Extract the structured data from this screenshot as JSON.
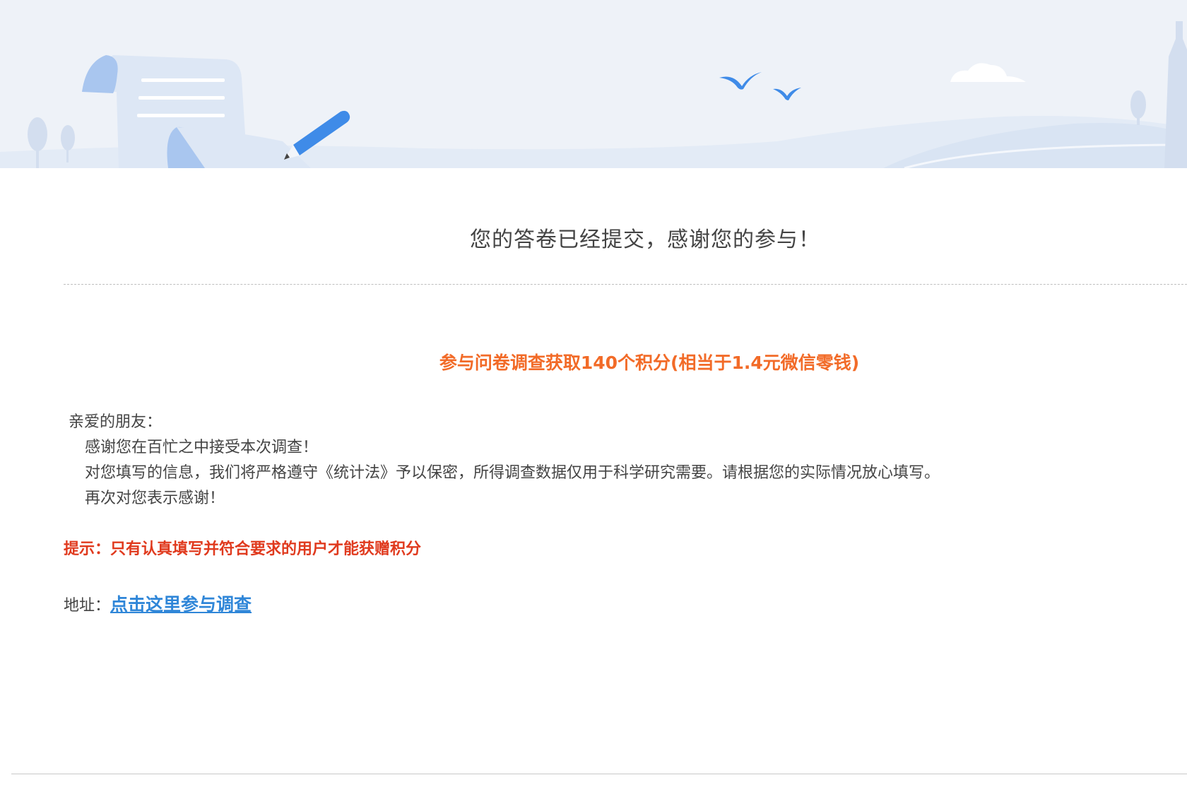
{
  "header": {
    "title": "您的答卷已经提交，感谢您的参与！"
  },
  "reward": {
    "text": "参与问卷调查获取140个积分(相当于1.4元微信零钱)"
  },
  "letter": {
    "greeting": "亲爱的朋友：",
    "lines": [
      "感谢您在百忙之中接受本次调查！",
      "对您填写的信息，我们将严格遵守《统计法》予以保密，所得调查数据仅用于科学研究需要。请根据您的实际情况放心填写。",
      "再次对您表示感谢！"
    ]
  },
  "tip": {
    "text": "提示：只有认真填写并符合要求的用户才能获赠积分"
  },
  "address": {
    "label": "地址：",
    "link_text": "点击这里参与调查"
  },
  "colors": {
    "reward_orange": "#f26b28",
    "tip_red": "#e03a1e",
    "link_blue": "#2f86d8",
    "banner_bg": "#eef2f8"
  }
}
